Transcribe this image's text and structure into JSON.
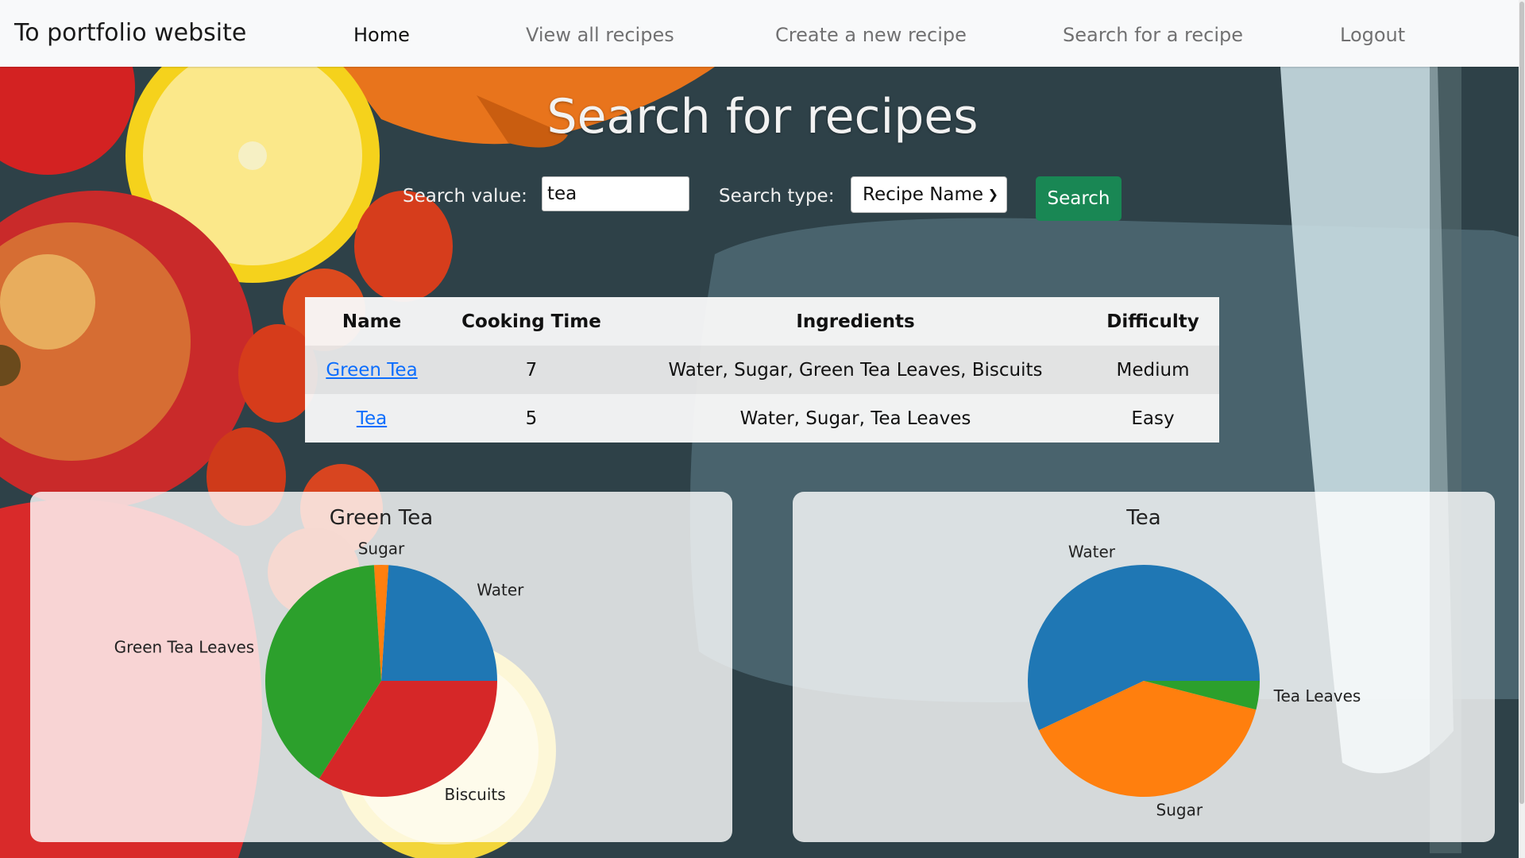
{
  "navbar": {
    "brand": "To portfolio website",
    "links": [
      {
        "label": "Home",
        "active": true
      },
      {
        "label": "View all recipes",
        "active": false
      },
      {
        "label": "Create a new recipe",
        "active": false
      },
      {
        "label": "Search for a recipe",
        "active": false
      },
      {
        "label": "Logout",
        "active": false
      }
    ]
  },
  "page": {
    "title": "Search for recipes"
  },
  "search": {
    "value_label": "Search value:",
    "value": "tea",
    "type_label": "Search type:",
    "type_selected": "Recipe Name",
    "button_label": "Search"
  },
  "table": {
    "headers": [
      "Name",
      "Cooking Time",
      "Ingredients",
      "Difficulty"
    ],
    "rows": [
      {
        "name": "Green Tea",
        "cooking_time": "7",
        "ingredients": "Water, Sugar, Green Tea Leaves, Biscuits",
        "difficulty": "Medium"
      },
      {
        "name": "Tea",
        "cooking_time": "5",
        "ingredients": "Water, Sugar, Tea Leaves",
        "difficulty": "Easy"
      }
    ]
  },
  "chart_data": [
    {
      "type": "pie",
      "title": "Green Tea",
      "series": [
        {
          "label": "Water",
          "value": 24,
          "color": "#1f77b4"
        },
        {
          "label": "Sugar",
          "value": 2,
          "color": "#ff7f0e"
        },
        {
          "label": "Green Tea Leaves",
          "value": 40,
          "color": "#2ca02c"
        },
        {
          "label": "Biscuits",
          "value": 34,
          "color": "#d62728"
        }
      ]
    },
    {
      "type": "pie",
      "title": "Tea",
      "series": [
        {
          "label": "Water",
          "value": 57,
          "color": "#1f77b4"
        },
        {
          "label": "Sugar",
          "value": 39,
          "color": "#ff7f0e"
        },
        {
          "label": "Tea Leaves",
          "value": 4,
          "color": "#2ca02c"
        }
      ]
    }
  ]
}
